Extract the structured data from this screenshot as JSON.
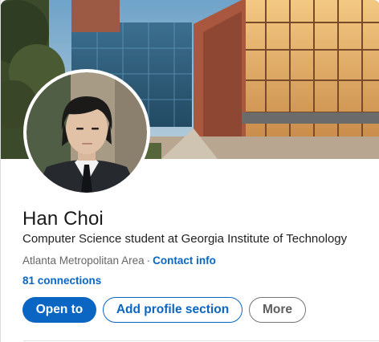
{
  "profile": {
    "name": "Han Choi",
    "headline": "Computer Science student at Georgia Institute of Technology",
    "location": "Atlanta Metropolitan Area",
    "separator": "·",
    "contact_label": "Contact info",
    "connections": "81 connections"
  },
  "actions": {
    "open_to": "Open to",
    "add_section": "Add profile section",
    "more": "More"
  },
  "colors": {
    "accent": "#0a66c2",
    "text_primary": "#1a1a1a",
    "text_muted": "#666666"
  },
  "images": {
    "banner": "campus-building-photo",
    "avatar": "profile-photo"
  }
}
